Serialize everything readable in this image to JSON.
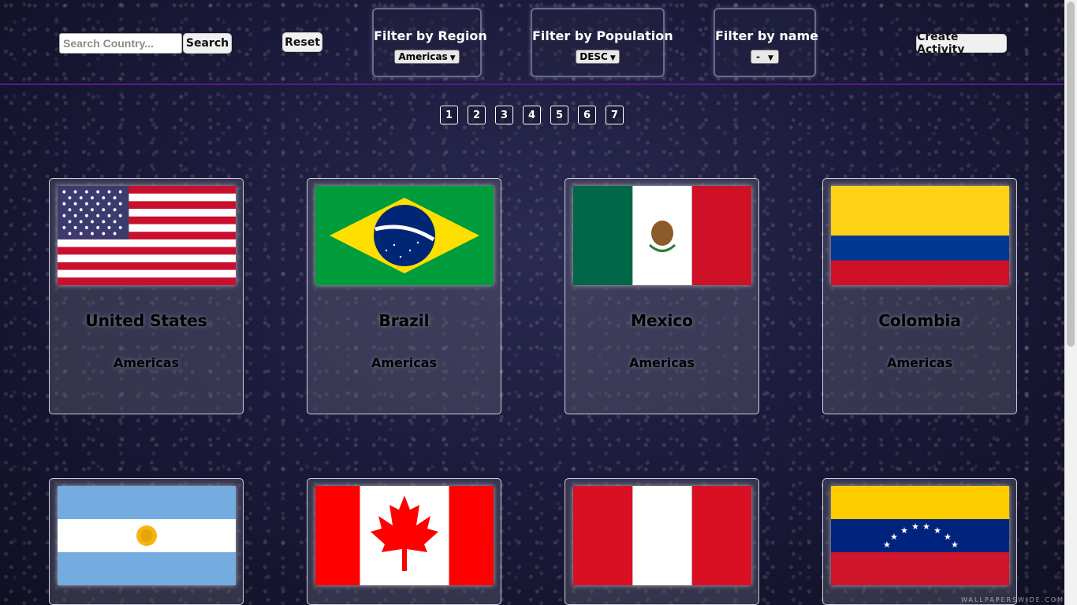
{
  "search": {
    "placeholder": "Search Country...",
    "button_label": "Search"
  },
  "reset_label": "Reset",
  "create_activity_label": "Create Activity",
  "filters": {
    "region": {
      "title": "Filter by Region",
      "selected": "Americas"
    },
    "population": {
      "title": "Filter by Population",
      "selected": "DESC"
    },
    "name": {
      "title": "Filter by name",
      "selected": "-"
    }
  },
  "pages": [
    "1",
    "2",
    "3",
    "4",
    "5",
    "6",
    "7"
  ],
  "countries": [
    {
      "name": "United States",
      "region": "Americas",
      "flag_icon": "us-flag-icon"
    },
    {
      "name": "Brazil",
      "region": "Americas",
      "flag_icon": "brazil-flag-icon"
    },
    {
      "name": "Mexico",
      "region": "Americas",
      "flag_icon": "mexico-flag-icon"
    },
    {
      "name": "Colombia",
      "region": "Americas",
      "flag_icon": "colombia-flag-icon"
    },
    {
      "name": "",
      "region": "",
      "flag_icon": "argentina-flag-icon"
    },
    {
      "name": "",
      "region": "",
      "flag_icon": "canada-flag-icon"
    },
    {
      "name": "",
      "region": "",
      "flag_icon": "peru-flag-icon"
    },
    {
      "name": "",
      "region": "",
      "flag_icon": "venezuela-flag-icon"
    }
  ],
  "colors": {
    "header_border": "#5a1a8a",
    "background": "#1c1b3d",
    "card_border": "#cfcfe0"
  },
  "watermark": "WALLPAPERSWIDE.COM"
}
